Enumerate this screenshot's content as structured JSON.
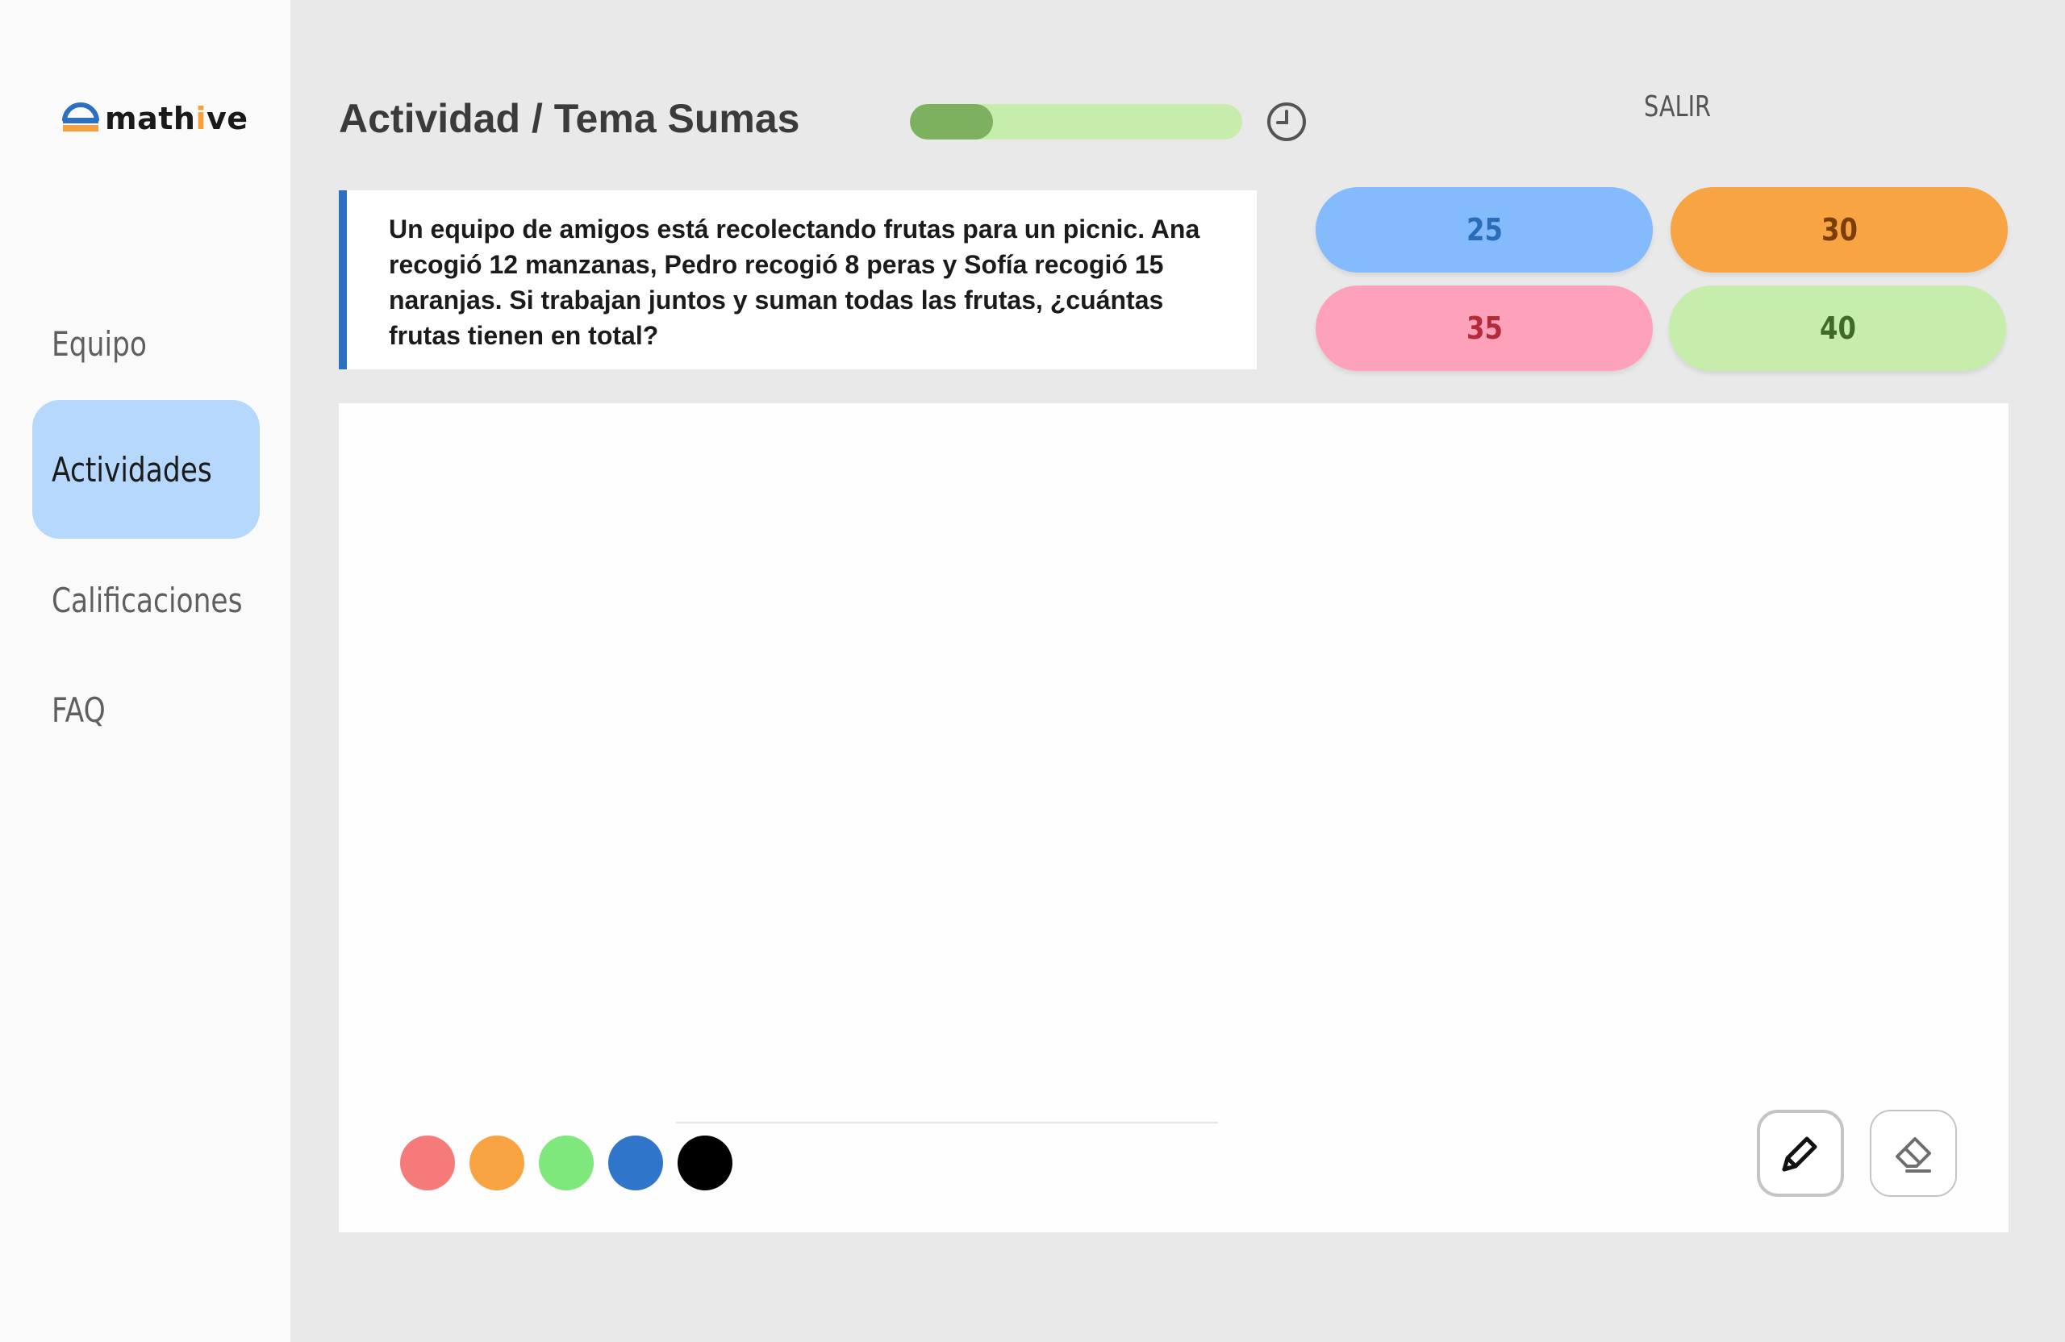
{
  "brand": {
    "name_prefix": "math",
    "name_highlight": "i",
    "name_suffix": "ve"
  },
  "sidebar": {
    "items": [
      {
        "label": "Equipo",
        "active": false
      },
      {
        "label": "Actividades",
        "active": true
      },
      {
        "label": "Calificaciones",
        "active": false
      },
      {
        "label": "FAQ",
        "active": false
      }
    ]
  },
  "header": {
    "title": "Actividad / Tema Sumas",
    "progress_fraction": 0.25,
    "timer_icon": "clock-icon",
    "exit_label": "SALIR"
  },
  "question": {
    "text": "Un equipo de amigos está recolectando frutas para un picnic. Ana recogió 12 manzanas, Pedro recogió 8 peras y Sofía recogió 15 naranjas. Si trabajan juntos y suman todas las frutas, ¿cuántas frutas tienen en total?"
  },
  "answers": [
    {
      "label": "25",
      "color": "#84bbfd"
    },
    {
      "label": "30",
      "color": "#f8a442"
    },
    {
      "label": "35",
      "color": "#fea1ba"
    },
    {
      "label": "40",
      "color": "#c6edab"
    }
  ],
  "canvas": {
    "colors": [
      "#f67a7a",
      "#f8a442",
      "#7ee87c",
      "#2f75c9",
      "#000000"
    ],
    "tools": [
      {
        "name": "pencil-icon",
        "selected": true
      },
      {
        "name": "eraser-icon",
        "selected": false
      }
    ]
  },
  "theme": {
    "accent": "#2d6fc0",
    "active_nav": "#b7d8fd",
    "progress_fill": "#7eb15f",
    "progress_track": "#c6edab"
  }
}
